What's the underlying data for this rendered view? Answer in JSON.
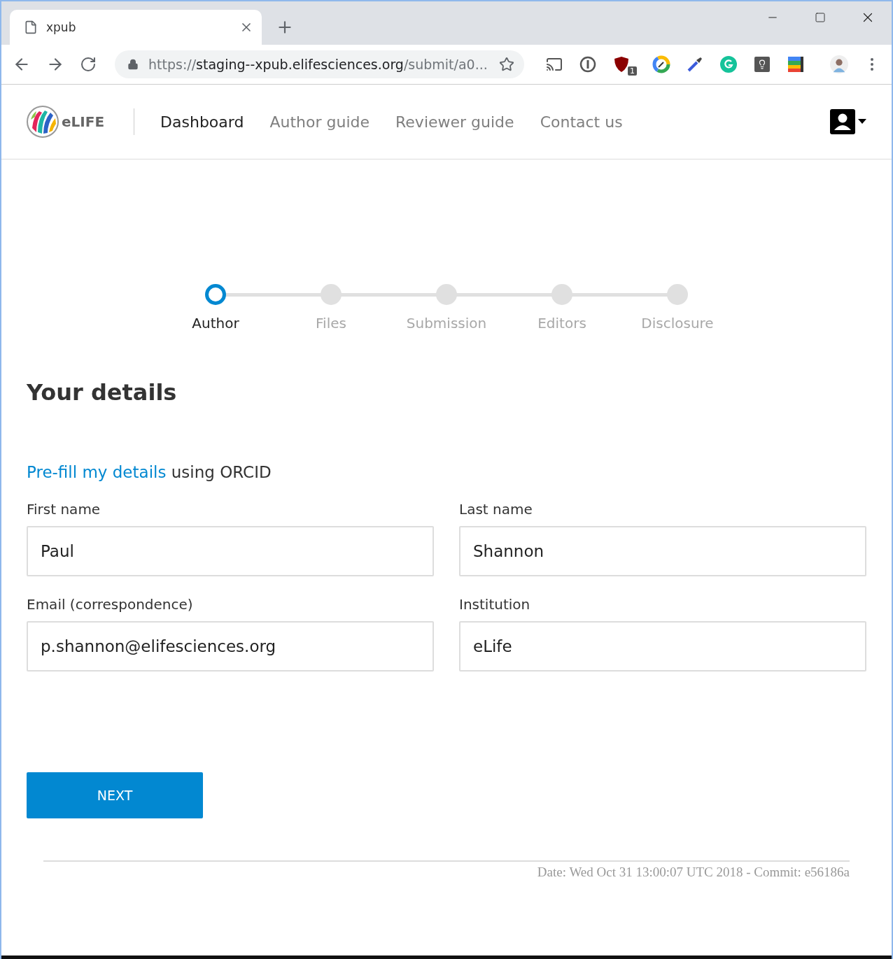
{
  "browser": {
    "tab_title": "xpub",
    "url_scheme": "https://",
    "url_host": "staging--xpub.elifesciences.org",
    "url_path": "/submit/a0...",
    "extension_badge": "1"
  },
  "header": {
    "logo_text": "eLIFE",
    "nav": [
      {
        "label": "Dashboard",
        "selected": true
      },
      {
        "label": "Author guide",
        "selected": false
      },
      {
        "label": "Reviewer guide",
        "selected": false
      },
      {
        "label": "Contact us",
        "selected": false
      }
    ]
  },
  "steps": [
    {
      "label": "Author",
      "selected": true
    },
    {
      "label": "Files",
      "selected": false
    },
    {
      "label": "Submission",
      "selected": false
    },
    {
      "label": "Editors",
      "selected": false
    },
    {
      "label": "Disclosure",
      "selected": false
    }
  ],
  "title": "Your details",
  "orcid": {
    "link": "Pre-fill my details",
    "text": "using ORCID"
  },
  "fields": [
    {
      "label": "First name",
      "value": "Paul"
    },
    {
      "label": "Last name",
      "value": "Shannon"
    },
    {
      "label": "Email (correspondence)",
      "value": "p.shannon@elifesciences.org"
    },
    {
      "label": "Institution",
      "value": "eLife"
    }
  ],
  "next_button": "NEXT",
  "footer": "Date: Wed Oct 31 13:00:07 UTC 2018 - Commit: e56186a"
}
